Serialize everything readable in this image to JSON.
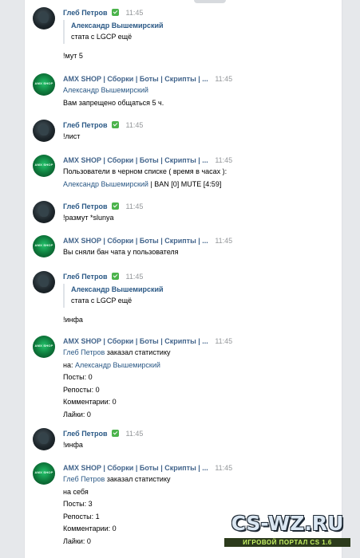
{
  "messages": [
    {
      "author": "Глеб Петров",
      "time": "11:45",
      "verified": true,
      "quote": {
        "author": "Александр Вышемирский",
        "text": "стата с LGCP ещё"
      },
      "lines": [
        "!мут 5"
      ]
    },
    {
      "author": "AMX SHOP | Сборки | Боты | Скрипты | ...",
      "time": "11:45",
      "link_line": "Александр Вышемирский",
      "lines": [
        "Вам запрещено общаться 5 ч."
      ]
    },
    {
      "author": "Глеб Петров",
      "time": "11:45",
      "verified": true,
      "lines": [
        "!лист"
      ]
    },
    {
      "author": "AMX SHOP | Сборки | Боты | Скрипты | ...",
      "time": "11:45",
      "lines": [
        "Пользователи в черном списке ( время в часах ):"
      ],
      "mixed_line": {
        "link": "Александр Вышемирский",
        "text": " | BAN [0] MUTE [4:59]"
      }
    },
    {
      "author": "Глеб Петров",
      "time": "11:45",
      "verified": true,
      "lines": [
        "!размут *slunya"
      ]
    },
    {
      "author": "AMX SHOP | Сборки | Боты | Скрипты | ...",
      "time": "11:45",
      "lines": [
        "Вы сняли бан чата у пользователя"
      ]
    },
    {
      "author": "Глеб Петров",
      "time": "11:45",
      "verified": true,
      "quote": {
        "author": "Александр Вышемирский",
        "text": "стата с LGCP ещё"
      },
      "lines": [
        "!инфа"
      ]
    },
    {
      "author": "AMX SHOP | Сборки | Боты | Скрипты | ...",
      "time": "11:45",
      "first_line": {
        "link": "Глеб Петров",
        "text": " заказал статистику"
      },
      "target_line": {
        "prefix": "на: ",
        "link": "Александр Вышемирский"
      },
      "lines": [
        "Посты: 0",
        "Репосты: 0",
        "Комментарии: 0",
        "Лайки: 0"
      ]
    },
    {
      "author": "Глеб Петров",
      "time": "11:45",
      "verified": true,
      "lines": [
        "!инфа"
      ]
    },
    {
      "author": "AMX SHOP | Сборки | Боты | Скрипты | ...",
      "time": "11:45",
      "first_line": {
        "link": "Глеб Петров",
        "text": " заказал статистику"
      },
      "lines": [
        "на себя",
        "Посты: 3",
        "Репосты: 1",
        "Комментарии: 0",
        "Лайки: 0"
      ]
    }
  ],
  "avatar_label": "AMX SHOP",
  "watermark": {
    "main": "CS-WZ.RU",
    "sub": "ИГРОВОЙ ПОРТАЛ CS 1.6"
  },
  "colors": {
    "link": "#2a5885",
    "verified": "#4bb34b",
    "time": "#939699",
    "background": "#ffffff"
  }
}
